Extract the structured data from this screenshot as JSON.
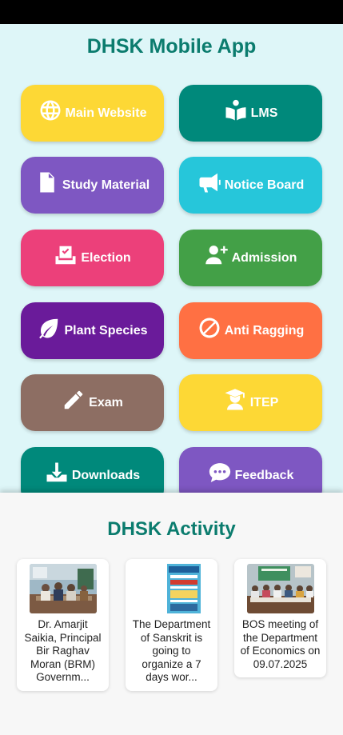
{
  "app": {
    "title": "DHSK Mobile App"
  },
  "menu": [
    {
      "label": "Main Website",
      "icon": "globe-icon",
      "color": "#fdd835"
    },
    {
      "label": "LMS",
      "icon": "book-reader-icon",
      "color": "#00897b"
    },
    {
      "label": "Study Material",
      "icon": "document-icon",
      "color": "#7e57c2"
    },
    {
      "label": "Notice Board",
      "icon": "megaphone-icon",
      "color": "#26c6da"
    },
    {
      "label": "Election",
      "icon": "ballot-box-icon",
      "color": "#ec407a"
    },
    {
      "label": "Admission",
      "icon": "user-plus-icon",
      "color": "#43a047"
    },
    {
      "label": "Plant Species",
      "icon": "leaf-icon",
      "color": "#6a1b9a"
    },
    {
      "label": "Anti Ragging",
      "icon": "ban-icon",
      "color": "#ff7043"
    },
    {
      "label": "Exam",
      "icon": "pencil-icon",
      "color": "#8d6e63"
    },
    {
      "label": "ITEP",
      "icon": "graduate-icon",
      "color": "#fdd835"
    },
    {
      "label": "Downloads",
      "icon": "download-icon",
      "color": "#00897b"
    },
    {
      "label": "Feedback",
      "icon": "chat-icon",
      "color": "#7e57c2"
    }
  ],
  "activity": {
    "title": "DHSK Activity",
    "items": [
      {
        "caption": "Dr. Amarjit Saikia, Principal Bir Raghav Moran (BRM) Governm..."
      },
      {
        "caption": "The Department of Sanskrit is going to organize a 7 days wor..."
      },
      {
        "caption": "BOS meeting of the Department of Economics on 09.07.2025"
      }
    ]
  },
  "colors": {
    "accent": "#0b7c6e",
    "background": "#def6f8",
    "sheet": "#f7f7f7"
  }
}
